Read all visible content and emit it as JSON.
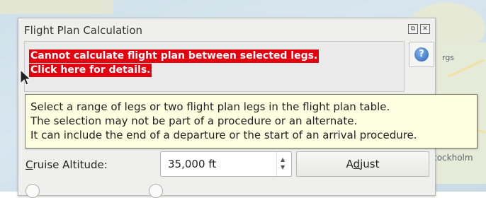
{
  "map": {
    "labels": [
      "rgs",
      "tockholm"
    ]
  },
  "dialog": {
    "title": "Flight Plan Calculation",
    "float_icon": "⧉",
    "close_icon": "✕",
    "error": {
      "line1": "Cannot calculate flight plan between selected legs.",
      "line2": "Click here for details."
    },
    "help_glyph": "?"
  },
  "tooltip": {
    "lines": [
      "Select a range of legs or two flight plan legs in the flight plan table.",
      "The selection may not be part of a procedure or an alternate.",
      "It can include the end of a departure or the start of an arrival procedure."
    ]
  },
  "cruise": {
    "label_mnemonic": "C",
    "label_rest": "ruise Altitude:",
    "value": "35,000 ft",
    "adjust_pre": "A",
    "adjust_mnemonic": "d",
    "adjust_post": "just"
  },
  "colors": {
    "error_bg": "#e3000f",
    "tooltip_bg": "#fefee0"
  }
}
